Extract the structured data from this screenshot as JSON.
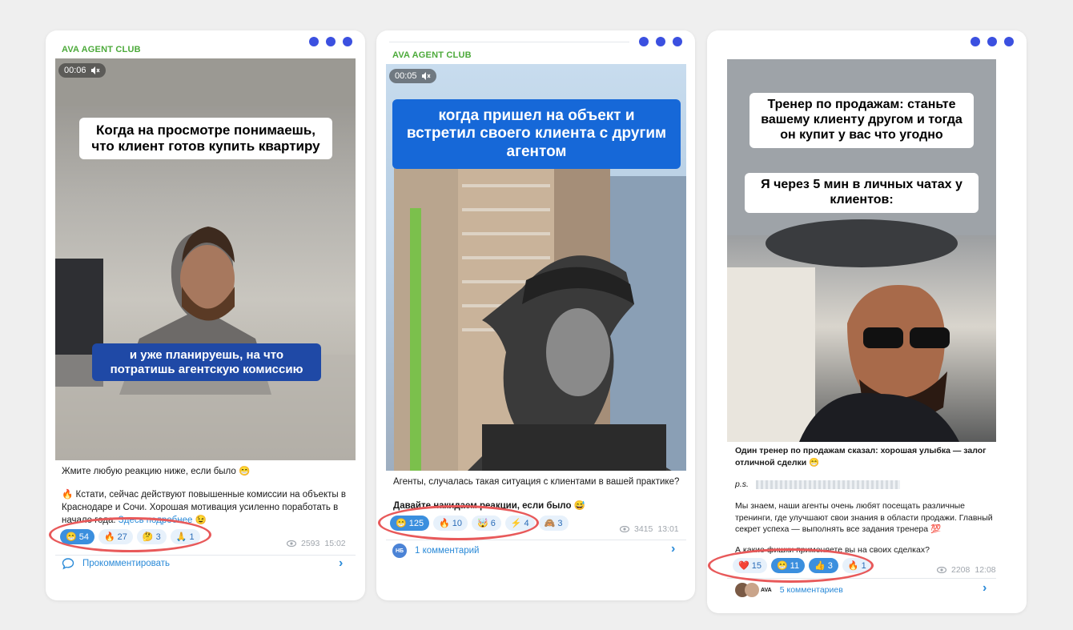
{
  "colors": {
    "accent_dot": "#3b50e0",
    "channel_green": "#4caa3a",
    "link_blue": "#2a8ad8",
    "reaction_bg": "#e7f1fb",
    "reaction_active": "#3b8fde",
    "highlight_oval": "#e8595a"
  },
  "posts": [
    {
      "channel": "AVA AGENT CLUB",
      "video_time": "00:06",
      "caption_top": "Когда на просмотре понимаешь, что клиент готов купить квартиру",
      "caption_bottom": "и уже планируешь, на что потратишь агентскую комиссию",
      "line1": "Жмите любую реакцию ниже, если было 😁",
      "line2": "🔥 Кстати, сейчас действуют повышенные комиссии на объекты в Краснодаре и Сочи. Хорошая мотивация усиленно поработать в начале года.",
      "link": "Здесь подробнее",
      "link_emoji": "😉",
      "reactions": [
        {
          "emoji": "😁",
          "count": "54",
          "active": true
        },
        {
          "emoji": "🔥",
          "count": "27"
        },
        {
          "emoji": "🤔",
          "count": "3"
        },
        {
          "emoji": "🙏",
          "count": "1"
        }
      ],
      "views": "2593",
      "time": "15:02",
      "footer_label": "Прокомментировать",
      "footer_icon": "comment-bubble-icon"
    },
    {
      "channel": "AVA AGENT CLUB",
      "video_time": "00:05",
      "caption_top": "когда пришел на объект и встретил своего клиента с другим агентом",
      "line1": "Агенты, случалась такая ситуация с клиентами в вашей практике?",
      "line2": "Давайте накидаем реакции, если было 😅",
      "reactions": [
        {
          "emoji": "😁",
          "count": "125",
          "active": true
        },
        {
          "emoji": "🔥",
          "count": "10"
        },
        {
          "emoji": "🤯",
          "count": "6"
        },
        {
          "emoji": "⚡",
          "count": "4"
        },
        {
          "emoji": "🙈",
          "count": "3"
        }
      ],
      "views": "3415",
      "time": "13:01",
      "avatar_initials": "НБ",
      "footer_label": "1 комментарий"
    },
    {
      "caption_top": "Тренер по продажам: станьте вашему клиенту другом и тогда он купит у вас что угодно",
      "caption_mid": "Я через 5 мин в личных чатах у клиентов:",
      "line1": "Один тренер по продажам сказал: хорошая улыбка — залог отличной сделки 😁",
      "ps": "p.s.",
      "line2": "Мы знаем, наши агенты очень любят посещать различные тренинги, где улучшают свои знания в области продажи. Главный секрет успеха — выполнять все задания тренера 💯",
      "line3": "А какие фишки применяете вы на своих сделках?",
      "reactions": [
        {
          "emoji": "❤️",
          "count": "15"
        },
        {
          "emoji": "😁",
          "count": "11",
          "active": true
        },
        {
          "emoji": "👍",
          "count": "3",
          "active": true
        },
        {
          "emoji": "🔥",
          "count": "1"
        }
      ],
      "views": "2208",
      "time": "12:08",
      "avatar_text": "AVA",
      "footer_label": "5 комментариев"
    }
  ]
}
